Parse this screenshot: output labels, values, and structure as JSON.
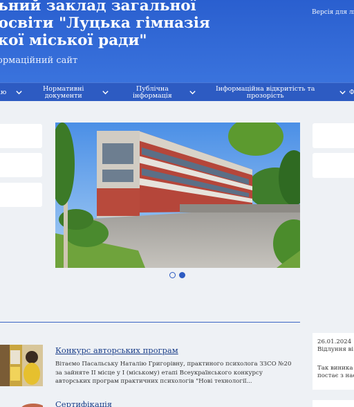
{
  "header": {
    "title_lines": [
      "льний заклад загальної",
      "ї освіти \"Луцька гімназія",
      "ької міської ради\""
    ],
    "subtitle": "ормаційний сайт",
    "accessibility_link": "Версія для лю"
  },
  "nav": {
    "items": [
      {
        "label": "ію"
      },
      {
        "label_lines": [
          "Нормативні",
          "документи"
        ]
      },
      {
        "label_lines": [
          "Публічна",
          "інформація"
        ]
      },
      {
        "label_lines": [
          "Інформаційна відкритість та",
          "прозорість"
        ]
      },
      {
        "label": "Ф"
      }
    ]
  },
  "carousel": {
    "slides": 2,
    "active_slide": 2
  },
  "news": [
    {
      "title": "Конкурс авторських програм",
      "text": "Вітаємо Пасальську Наталію Григорівну, практиного психолога ЗЗСО №20 за зайняте ІІ місце у І (міському) етапі Всеукраїнського конкурсу авторських програм практичних психологів \"Нові технології..."
    },
    {
      "title": "Сертифікація",
      "text": ""
    }
  ],
  "side_news": {
    "date": "26.01.2024",
    "title": "Відлуння ві",
    "text_lines": [
      "Так виника",
      "постає з нас"
    ]
  },
  "colors": {
    "header_bg": "#2a5fcf",
    "nav_bg": "#2d5bc2",
    "page_bg": "#eef1f5",
    "link": "#1b3f8a"
  }
}
